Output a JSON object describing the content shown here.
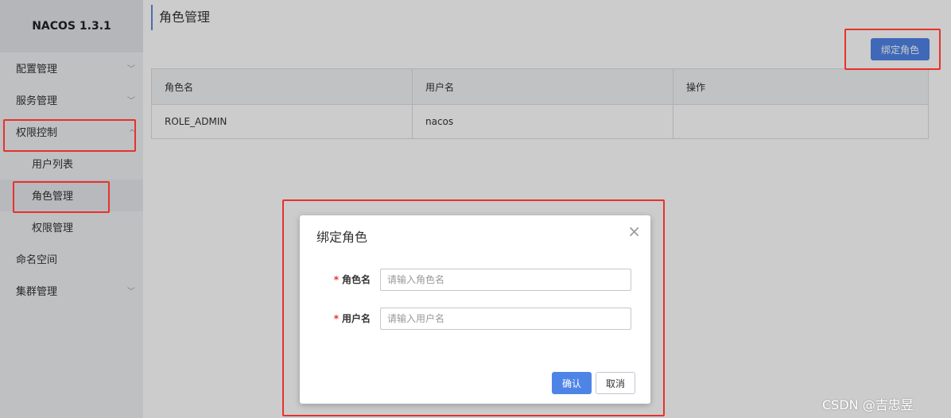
{
  "brand": "NACOS 1.3.1",
  "sidebar": {
    "items": [
      {
        "label": "配置管理",
        "chevron": "﹀"
      },
      {
        "label": "服务管理",
        "chevron": "﹀"
      },
      {
        "label": "权限控制",
        "chevron": "^"
      },
      {
        "label": "用户列表"
      },
      {
        "label": "角色管理"
      },
      {
        "label": "权限管理"
      },
      {
        "label": "命名空间"
      },
      {
        "label": "集群管理",
        "chevron": "﹀"
      }
    ]
  },
  "page": {
    "title": "角色管理",
    "bind_button": "绑定角色",
    "table": {
      "headers": [
        "角色名",
        "用户名",
        "操作"
      ],
      "rows": [
        [
          "ROLE_ADMIN",
          "nacos",
          ""
        ]
      ]
    }
  },
  "dialog": {
    "title": "绑定角色",
    "close": "×",
    "required_mark": "*",
    "fields": [
      {
        "label": "角色名",
        "placeholder": "请输入角色名",
        "value": ""
      },
      {
        "label": "用户名",
        "placeholder": "请输入用户名",
        "value": ""
      }
    ],
    "ok": "确认",
    "cancel": "取消"
  },
  "watermark": "CSDN @吉忠昱",
  "colors": {
    "primary": "#4f84e7",
    "highlight": "#e8312c"
  }
}
